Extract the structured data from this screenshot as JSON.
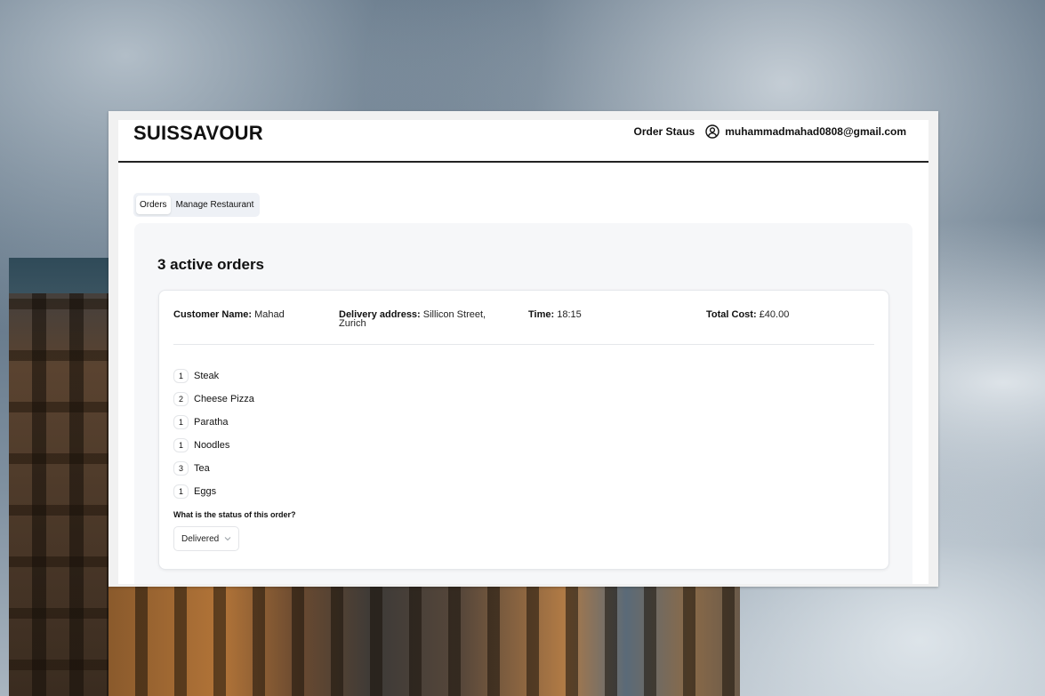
{
  "app": {
    "brand": "SUISSAVOUR",
    "order_status_link": "Order Staus",
    "user_email": "muhammadmahad0808@gmail.com"
  },
  "tabs": [
    {
      "label": "Orders",
      "active": true
    },
    {
      "label": "Manage Restaurant",
      "active": false
    }
  ],
  "orders_panel": {
    "title": "3 active orders"
  },
  "order": {
    "customer_label": "Customer Name:",
    "customer_value": "Mahad",
    "address_label": "Delivery address:",
    "address_value": "Sillicon Street, Zurich",
    "time_label": "Time:",
    "time_value": "18:15",
    "cost_label": "Total Cost:",
    "cost_value": "£40.00",
    "items": [
      {
        "qty": "1",
        "name": "Steak"
      },
      {
        "qty": "2",
        "name": "Cheese Pizza"
      },
      {
        "qty": "1",
        "name": "Paratha"
      },
      {
        "qty": "1",
        "name": "Noodles"
      },
      {
        "qty": "3",
        "name": "Tea"
      },
      {
        "qty": "1",
        "name": "Eggs"
      }
    ],
    "status_question": "What is the status of this order?",
    "status_value": "Delivered"
  },
  "icons": {
    "user": "user-circle-icon",
    "dropdown": "chevron-down-icon"
  }
}
